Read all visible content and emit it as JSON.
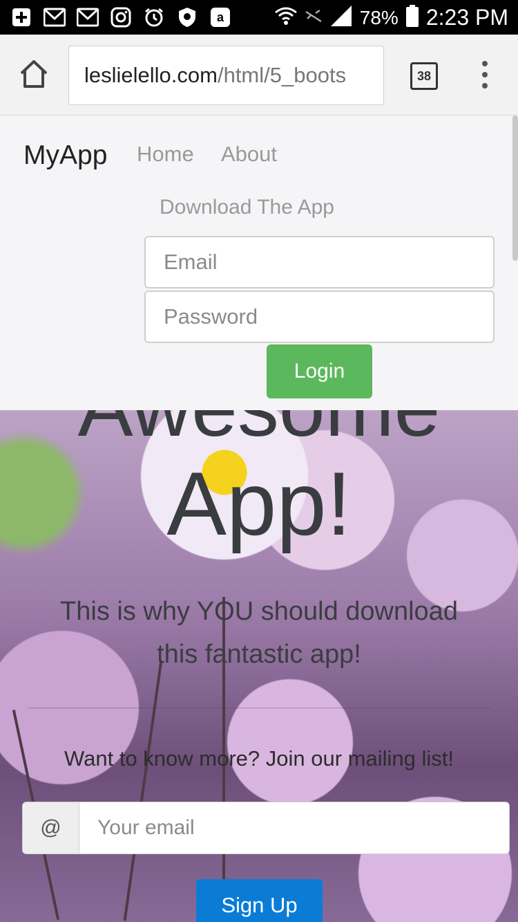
{
  "status_bar": {
    "left_icons": [
      "plus-icon",
      "gmail-icon",
      "gmail-icon",
      "instagram-icon",
      "alarm-icon",
      "shield-icon",
      "amazon-icon"
    ],
    "battery": "78%",
    "time": "2:23 PM"
  },
  "browser": {
    "url_domain": "leslielello.com",
    "url_path": "/html/5_boots",
    "tab_count": "38"
  },
  "navbar": {
    "brand": "MyApp",
    "links": [
      "Home",
      "About"
    ],
    "download": "Download The App",
    "email_placeholder": "Email",
    "password_placeholder": "Password",
    "login_label": "Login"
  },
  "hero": {
    "title_line1": "Awesome",
    "title_line2": "App!",
    "tagline": "This is why YOU should download this fantastic app!",
    "mailing_prompt": "Want to know more? Join our mailing list!",
    "at_symbol": "@",
    "email_placeholder": "Your email",
    "signup_label": "Sign Up"
  },
  "colors": {
    "login_green": "#5cb85c",
    "signup_blue": "#0b7cd6",
    "navbar_bg": "#f5f5f7"
  }
}
